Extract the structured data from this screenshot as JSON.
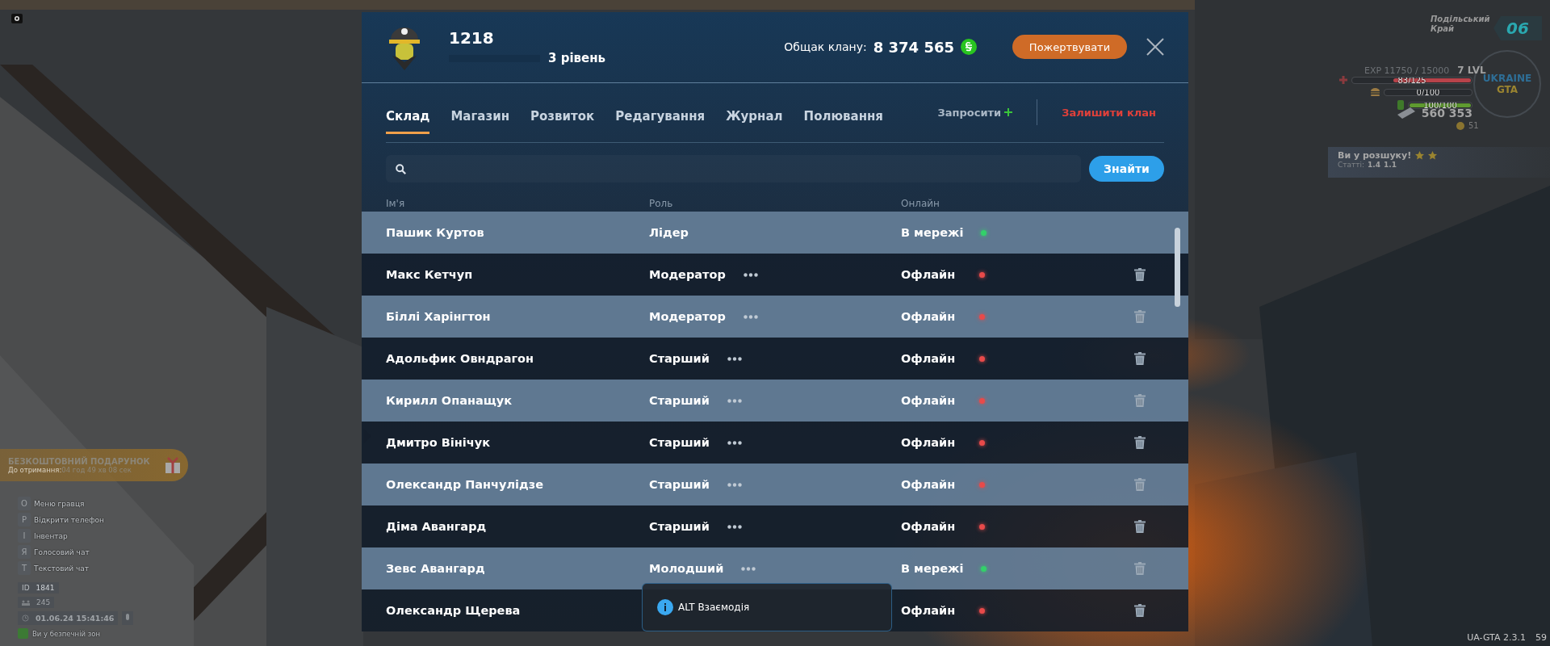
{
  "panel": {
    "clan_id": "1218",
    "level_label": "3 рівень",
    "level": 0,
    "treasury_label": "Общак клану:",
    "treasury_value": "8 374 565",
    "donate_button": "Пожертвувати",
    "tabs": [
      {
        "label": "Склад",
        "selected": true
      },
      {
        "label": "Магазин",
        "selected": false
      },
      {
        "label": "Розвиток",
        "selected": false
      },
      {
        "label": "Редагування",
        "selected": false
      },
      {
        "label": "Журнал",
        "selected": false
      },
      {
        "label": "Полювання",
        "selected": false
      }
    ],
    "invite": "Запросити",
    "leave": "Залишити клан",
    "search_button": "Знайти",
    "columns": [
      "Ім'я",
      "Роль",
      "Онлайн"
    ],
    "rows": [
      {
        "name": "Пашик Куртов",
        "role": "Лідер",
        "status": "В мережі",
        "online": true,
        "menu": false,
        "deletable": false
      },
      {
        "name": "Макс Кетчуп",
        "role": "Модератор",
        "status": "Офлайн",
        "online": false,
        "menu": true,
        "deletable": true
      },
      {
        "name": "Біллі Харінгтон",
        "role": "Модератор",
        "status": "Офлайн",
        "online": false,
        "menu": true,
        "deletable": true
      },
      {
        "name": "Адольфик Овндрагон",
        "role": "Старший",
        "status": "Офлайн",
        "online": false,
        "menu": true,
        "deletable": true
      },
      {
        "name": "Кирилл Опанащук",
        "role": "Старший",
        "status": "Офлайн",
        "online": false,
        "menu": true,
        "deletable": true
      },
      {
        "name": "Дмитро Вінічук",
        "role": "Старший",
        "status": "Офлайн",
        "online": false,
        "menu": true,
        "deletable": true
      },
      {
        "name": "Олександр Панчулідзе",
        "role": "Старший",
        "status": "Офлайн",
        "online": false,
        "menu": true,
        "deletable": true
      },
      {
        "name": "Діма Авангард",
        "role": "Старший",
        "status": "Офлайн",
        "online": false,
        "menu": true,
        "deletable": true
      },
      {
        "name": "Зевс Авангард",
        "role": "Молодший",
        "status": "В мережі",
        "online": true,
        "menu": true,
        "deletable": true
      },
      {
        "name": "Олександр Щерева",
        "status": "Офлайн",
        "online": false,
        "menu": false,
        "deletable": true
      }
    ],
    "tooltip": "ALT Взаємодія"
  },
  "hud_right": {
    "region": "Подільський Край",
    "region_number": "06",
    "logo_top": "UKRAINE",
    "logo_bottom": "GTA",
    "exp": "EXP 11750 / 15000",
    "lvl": "7 LVL",
    "bars": [
      {
        "kind": "health",
        "label": "83/125",
        "level": 0.66
      },
      {
        "kind": "food",
        "label": "0/100"
      },
      {
        "kind": "stamina",
        "label": "100/100",
        "level": 1
      }
    ],
    "money": "560 353",
    "coins": "51",
    "wanted": "Ви у розшуку!",
    "stars": 2,
    "articles_label": "Статті:",
    "articles": [
      "1.4",
      "1.1"
    ]
  },
  "hud_left": {
    "gift_title": "БЕЗКОШТОВНИЙ ПОДАРУНОК",
    "gift_label": "До отримання:",
    "gift_timer": "04 год 49 хв 08 сек",
    "hints": [
      {
        "key": "O",
        "label": "Меню гравця"
      },
      {
        "key": "P",
        "label": "Відкрити телефон"
      },
      {
        "key": "I",
        "label": "Інвентар"
      },
      {
        "key": "Я",
        "label": "Голосовий чат"
      },
      {
        "key": "T",
        "label": "Текстовий чат"
      }
    ],
    "id_label": "ID",
    "id": "1841",
    "players": "245",
    "datetime": "01.06.24 15:41:46",
    "zone": "Ви у безпечній зон"
  },
  "version": "UA-GTA 2.3.1",
  "fps": "59"
}
